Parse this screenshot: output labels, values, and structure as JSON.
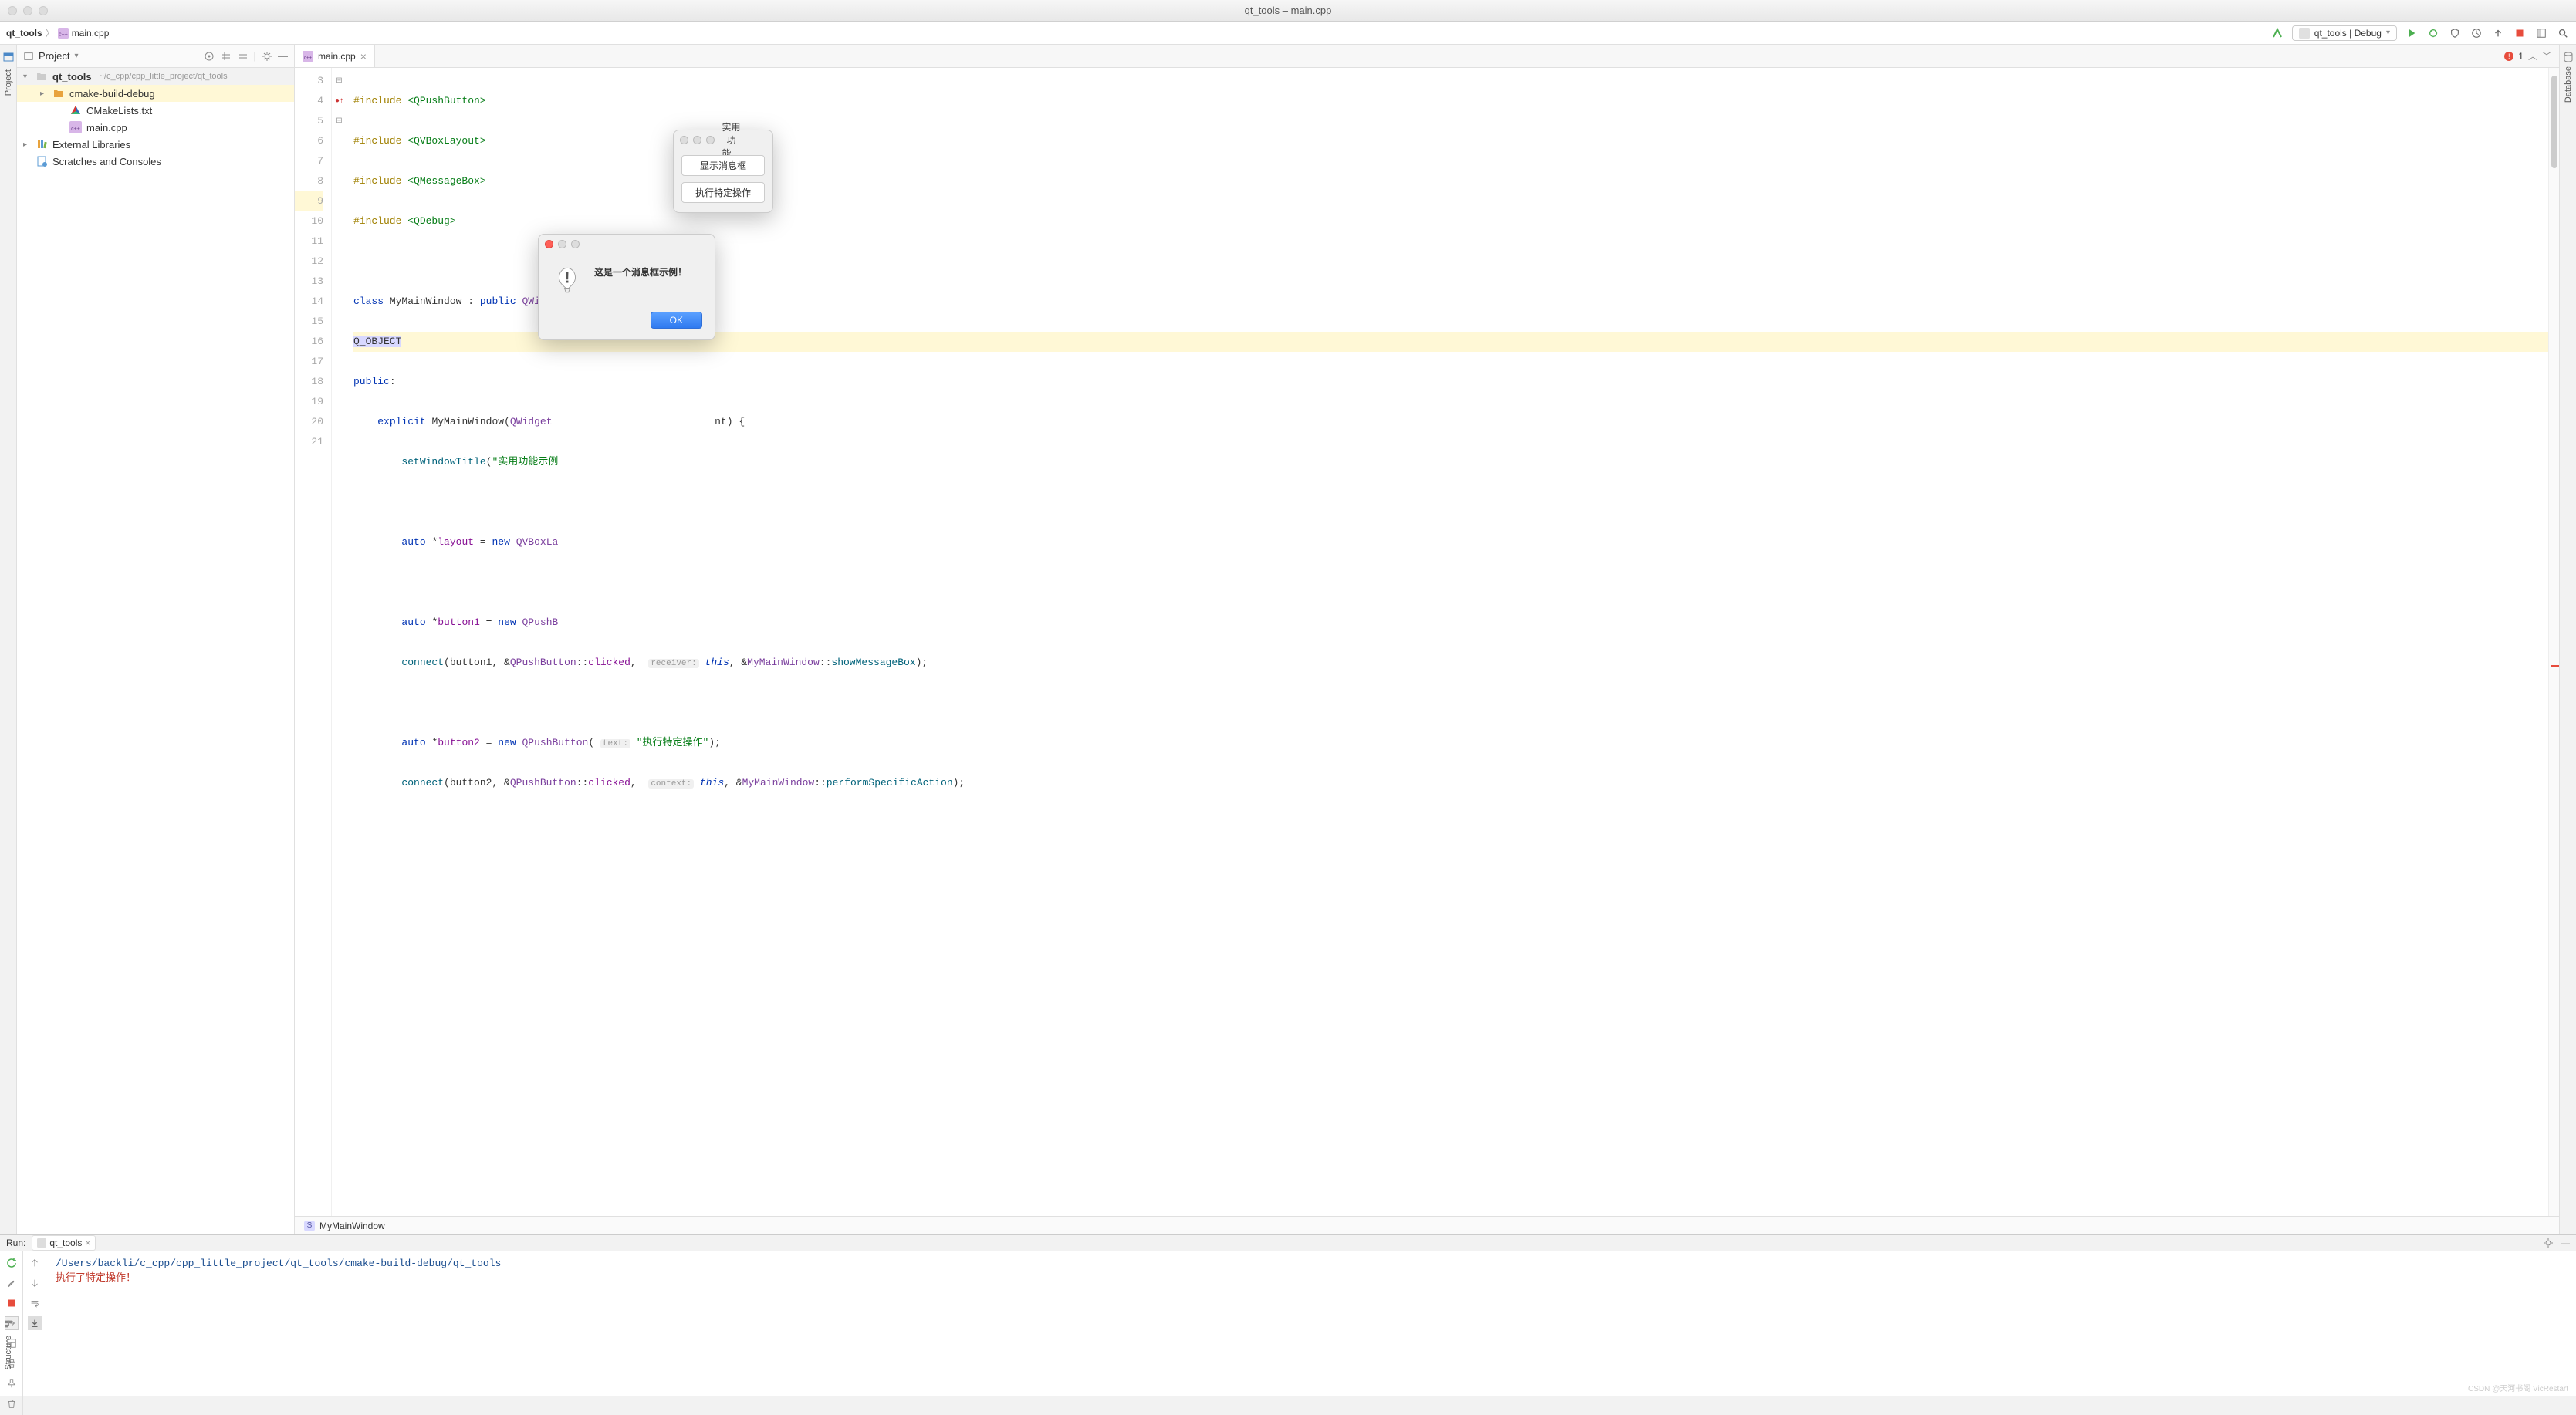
{
  "window": {
    "title": "qt_tools – main.cpp"
  },
  "breadcrumb": {
    "project": "qt_tools",
    "file": "main.cpp"
  },
  "runConfig": {
    "label": "qt_tools | Debug"
  },
  "projectPanel": {
    "title": "Project",
    "root": {
      "name": "qt_tools",
      "path": "~/c_cpp/cpp_little_project/qt_tools"
    },
    "children": [
      {
        "name": "cmake-build-debug",
        "kind": "folder"
      },
      {
        "name": "CMakeLists.txt",
        "kind": "cmake"
      },
      {
        "name": "main.cpp",
        "kind": "cpp"
      }
    ],
    "extLib": "External Libraries",
    "scratches": "Scratches and Consoles"
  },
  "editor": {
    "tab": "main.cpp",
    "errorCount": "1",
    "lines": {
      "3": {
        "pre": "#include ",
        "inc": "<QPushButton>"
      },
      "4": {
        "pre": "#include ",
        "inc": "<QVBoxLayout>"
      },
      "5": {
        "pre": "#include ",
        "inc": "<QMessageBox>"
      },
      "6": {
        "pre": "#include ",
        "inc": "<QDebug>"
      },
      "7": {
        "txt": ""
      },
      "8": {
        "txt": "class MyMainWindow : public QWidget {"
      },
      "9": {
        "txt": "Q_OBJECT"
      },
      "10": {
        "txt": "public:"
      },
      "11": {
        "txt": "    explicit MyMainWindow(QWidget                         nt) {"
      },
      "12": {
        "txt": "        setWindowTitle(\"实用功能示例"
      },
      "13": {
        "txt": ""
      },
      "14": {
        "txt": "        auto *layout = new QVBoxLa"
      },
      "15": {
        "txt": ""
      },
      "16": {
        "txt": "        auto *button1 = new QPushB"
      },
      "17": {
        "txt": "        connect(button1, &QPushButton::clicked,  receiver: this, &MyMainWindow::showMessageBox);"
      },
      "18": {
        "txt": ""
      },
      "19": {
        "txt": "        auto *button2 = new QPushButton( text: \"执行特定操作\");"
      },
      "20": {
        "txt": "        connect(button2, &QPushButton::clicked,  context: this, &MyMainWindow::performSpecificAction);"
      },
      "21": {
        "txt": ""
      }
    },
    "structCrumb": "MyMainWindow"
  },
  "runPanel": {
    "label": "Run:",
    "tab": "qt_tools",
    "consolePath": "/Users/backli/c_cpp/cpp_little_project/qt_tools/cmake-build-debug/qt_tools",
    "consoleOut": "执行了特定操作！"
  },
  "qtApp": {
    "title": "实用功能…",
    "btn1": "显示消息框",
    "btn2": "执行特定操作"
  },
  "qtMsg": {
    "text": "这是一个消息框示例！",
    "ok": "OK"
  },
  "leftRail": {
    "project": "Project",
    "structure": "Structure"
  },
  "rightRail": {
    "database": "Database"
  },
  "watermark": "CSDN @天河书阁 VicRestart"
}
